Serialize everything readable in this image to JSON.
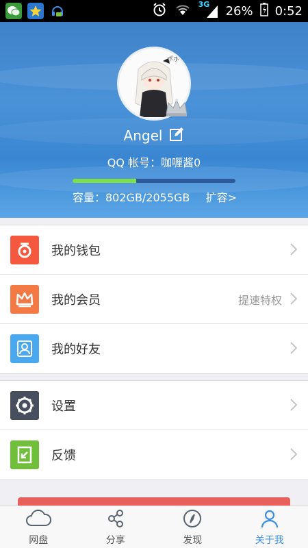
{
  "status_bar": {
    "network": "3G",
    "battery": "26%",
    "time": "0:52",
    "left_icons": [
      "wechat-icon",
      "star-icon",
      "qq-icon"
    ]
  },
  "profile": {
    "name": "Angel",
    "account": "QQ 帐号：咖喱酱0",
    "storage_used_fraction": 0.39,
    "capacity": "容量：802GB/2055GB",
    "expand": "扩容>"
  },
  "menu_group_1": [
    {
      "label": "我的钱包",
      "icon": "wallet-icon",
      "color": "#f4593f",
      "extra": ""
    },
    {
      "label": "我的会员",
      "icon": "crown-icon",
      "color": "#f47a45",
      "extra": "提速特权"
    },
    {
      "label": "我的好友",
      "icon": "friend-icon",
      "color": "#4aa8ef",
      "extra": ""
    }
  ],
  "menu_group_2": [
    {
      "label": "设置",
      "icon": "settings-icon",
      "color": "#474e5e",
      "extra": ""
    },
    {
      "label": "反馈",
      "icon": "feedback-icon",
      "color": "#6fbf3a",
      "extra": ""
    }
  ],
  "tabs": [
    {
      "label": "网盘",
      "icon": "cloud-icon",
      "active": false
    },
    {
      "label": "分享",
      "icon": "share-icon",
      "active": false
    },
    {
      "label": "发现",
      "icon": "compass-icon",
      "active": false
    },
    {
      "label": "关于我",
      "icon": "person-icon",
      "active": true
    }
  ],
  "colors": {
    "accent": "#3a8de0",
    "header": "#4a92d8",
    "progress": "#7de04a"
  }
}
